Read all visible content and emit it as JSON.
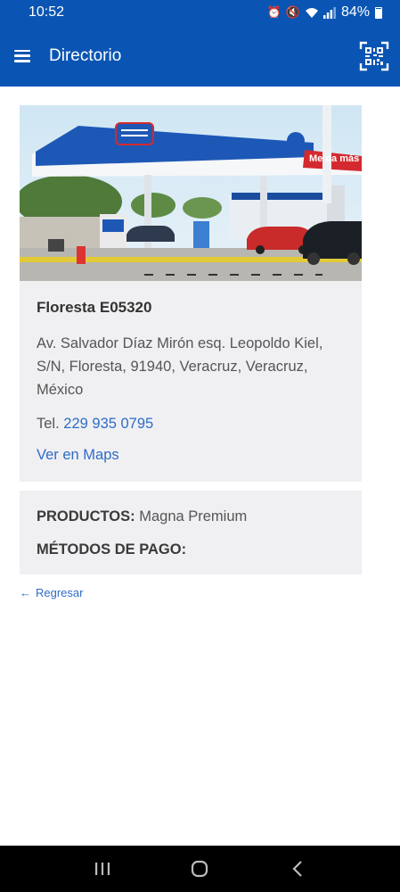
{
  "status_bar": {
    "time": "10:52",
    "battery": "84%"
  },
  "app_bar": {
    "title": "Directorio",
    "menu_icon": "hamburger-menu-icon",
    "qr_icon": "qr-scan-icon"
  },
  "station": {
    "photo_alt": "Floresta E05320",
    "name": "Floresta E05320",
    "address": "Av. Salvador Díaz Mirón esq. Leopoldo Kiel, S/N, Floresta, 91940, Veracruz, Veracruz, México",
    "tel_label": "Tel.",
    "tel_number": "229 935 0795",
    "maps_link": "Ver en Maps",
    "canopy_text": "Me da más"
  },
  "details": {
    "products_label": "PRODUCTOS:",
    "products_value": "Magna Premium",
    "payment_label": "MÉTODOS DE PAGO:"
  },
  "back_link": {
    "arrow": "←",
    "label": "Regresar"
  },
  "colors": {
    "primary": "#0a55b3",
    "link": "#2f6cc5",
    "card_bg": "#f0f0f3",
    "canopy_red": "#d42a2f"
  }
}
